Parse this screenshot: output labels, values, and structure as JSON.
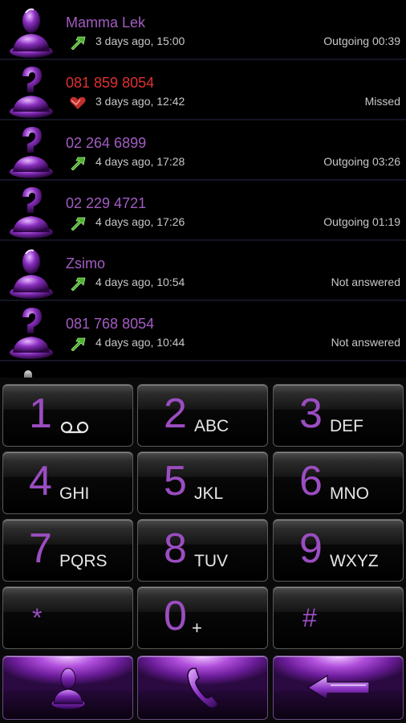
{
  "call_log": [
    {
      "name": "Mamma Lek",
      "direction": "outgoing",
      "when": "3 days ago, 15:00",
      "status": "Outgoing 00:39",
      "missed": false,
      "avatar": "contact-photo-icon"
    },
    {
      "name": "081 859 8054",
      "direction": "missed",
      "when": "3 days ago, 12:42",
      "status": "Missed",
      "missed": true,
      "avatar": "unknown-caller-icon"
    },
    {
      "name": "02 264 6899",
      "direction": "outgoing",
      "when": "4 days ago, 17:28",
      "status": "Outgoing 03:26",
      "missed": false,
      "avatar": "unknown-caller-icon"
    },
    {
      "name": "02 229 4721",
      "direction": "outgoing",
      "when": "4 days ago, 17:26",
      "status": "Outgoing 01:19",
      "missed": false,
      "avatar": "unknown-caller-icon"
    },
    {
      "name": "Zsimo",
      "direction": "outgoing",
      "when": "4 days ago, 10:54",
      "status": "Not answered",
      "missed": false,
      "avatar": "contact-photo-icon"
    },
    {
      "name": "081 768 8054",
      "direction": "outgoing",
      "when": "4 days ago, 10:44",
      "status": "Not answered",
      "missed": false,
      "avatar": "unknown-caller-icon"
    }
  ],
  "keypad": {
    "keys": [
      {
        "digit": "1",
        "letters": "",
        "icon": "voicemail-icon"
      },
      {
        "digit": "2",
        "letters": "ABC"
      },
      {
        "digit": "3",
        "letters": "DEF"
      },
      {
        "digit": "4",
        "letters": "GHI"
      },
      {
        "digit": "5",
        "letters": "JKL"
      },
      {
        "digit": "6",
        "letters": "MNO"
      },
      {
        "digit": "7",
        "letters": "PQRS"
      },
      {
        "digit": "8",
        "letters": "TUV"
      },
      {
        "digit": "9",
        "letters": "WXYZ"
      },
      {
        "digit": "*",
        "letters": ""
      },
      {
        "digit": "0",
        "letters": "+"
      },
      {
        "digit": "#",
        "letters": ""
      }
    ],
    "actions": [
      {
        "name": "contacts-button",
        "icon": "contact-icon"
      },
      {
        "name": "call-button",
        "icon": "phone-handset-icon"
      },
      {
        "name": "backspace-button",
        "icon": "backspace-arrow-icon"
      }
    ]
  },
  "colors": {
    "accent": "#9b4dc1",
    "name_text": "#a35cc2",
    "missed_text": "#e03030",
    "outgoing_arrow": "#4caf30",
    "missed_heart": "#c0302c",
    "background": "#000000"
  }
}
